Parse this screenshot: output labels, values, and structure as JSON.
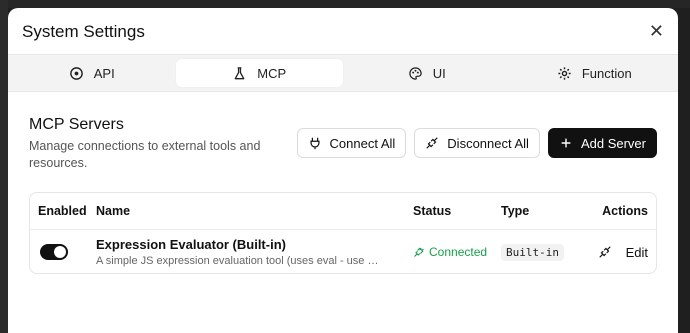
{
  "dialog": {
    "title": "System Settings",
    "close_glyph": "✕"
  },
  "tabs": [
    {
      "label": "API",
      "icon": "api-icon"
    },
    {
      "label": "MCP",
      "icon": "flask-icon",
      "active": true
    },
    {
      "label": "UI",
      "icon": "palette-icon"
    },
    {
      "label": "Function",
      "icon": "gear-icon"
    }
  ],
  "section": {
    "title": "MCP Servers",
    "description": "Manage connections to external tools and resources."
  },
  "buttons": {
    "connect_all": "Connect All",
    "disconnect_all": "Disconnect All",
    "add_server": "Add Server"
  },
  "table": {
    "headers": [
      "Enabled",
      "Name",
      "Status",
      "Type",
      "Actions"
    ],
    "rows": [
      {
        "enabled": true,
        "name": "Expression Evaluator (Built-in)",
        "description": "A simple JS expression evaluation tool (uses eval - use with…",
        "status": "Connected",
        "type": "Built-in",
        "edit_label": "Edit"
      }
    ]
  },
  "colors": {
    "accent_dark": "#111111",
    "status_connected": "#18a04a"
  }
}
